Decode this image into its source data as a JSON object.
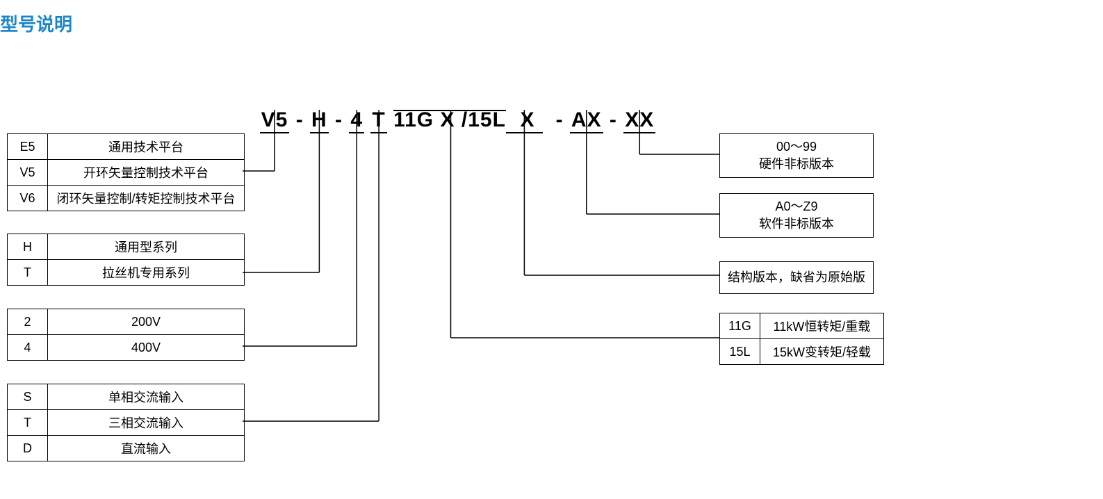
{
  "title": "型号说明",
  "model": {
    "p1": "V5",
    "p2": "H",
    "p3": "4",
    "p4": "T",
    "p5": "11G",
    "p6": "X",
    "p7": "/15L",
    "p8": "  X ",
    "p9": "AX",
    "p10": "XX"
  },
  "left": {
    "platform": [
      {
        "code": "E5",
        "desc": "通用技术平台"
      },
      {
        "code": "V5",
        "desc": "开环矢量控制技术平台"
      },
      {
        "code": "V6",
        "desc": "闭环矢量控制/转矩控制技术平台"
      }
    ],
    "series": [
      {
        "code": "H",
        "desc": "通用型系列"
      },
      {
        "code": "T",
        "desc": "拉丝机专用系列"
      }
    ],
    "voltage": [
      {
        "code": "2",
        "desc": "200V"
      },
      {
        "code": "4",
        "desc": "400V"
      }
    ],
    "input": [
      {
        "code": "S",
        "desc": "单相交流输入"
      },
      {
        "code": "T",
        "desc": "三相交流输入"
      },
      {
        "code": "D",
        "desc": "直流输入"
      }
    ]
  },
  "right": {
    "hw": {
      "l1": "00～99",
      "l2": "硬件非标版本"
    },
    "sw": {
      "l1": "A0～Z9",
      "l2": "软件非标版本"
    },
    "struct": "结构版本，缺省为原始版",
    "power": [
      {
        "code": "11G",
        "desc": "11kW恒转矩/重载"
      },
      {
        "code": "15L",
        "desc": "15kW变转矩/轻载"
      }
    ]
  }
}
